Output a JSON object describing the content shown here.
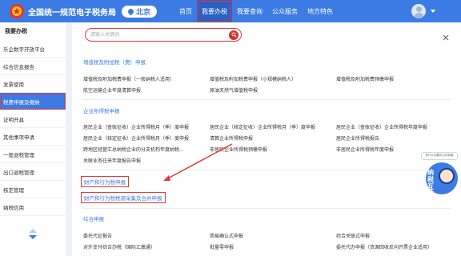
{
  "header": {
    "site_title": "全国统一规范电子税务局",
    "region": "北京",
    "nav": [
      "首页",
      "我要办税",
      "我要查询",
      "公众服务",
      "地方特色"
    ]
  },
  "sidebar": {
    "title": "我要办税",
    "items": [
      "乐企数字开放平台",
      "综合信息报告",
      "发票使用",
      "税费申报及缴纳",
      "证明开具",
      "其他事项申请",
      "一般退税管理",
      "出口退税管理",
      "核定管理",
      "纳税信用"
    ]
  },
  "search": {
    "placeholder": "请输入关键词"
  },
  "sections": {
    "vat": {
      "title": "增值税及附加税（费）申报",
      "rows": [
        [
          "增值税及附加税费申报（一般纳税人适用）",
          "增值税及附加税费申报（小规模纳税人）",
          "增值税及附加税费预缴申报"
        ],
        [
          "航空运输企业年度清算申报",
          "原油天然气增值税申报",
          ""
        ]
      ]
    },
    "cit": {
      "title": "企业所得税申报",
      "rows": [
        [
          "居民企业（查账征收）企业所得税月（季）度申报",
          "居民企业（核定征收）企业所得税月（季）度申报",
          "居民企业（查账征收）企业所得税年度申报"
        ],
        [
          "居民企业（核定征收）企业所得税月（季）度申报",
          "清算企业所得税申报",
          "居民企业所得税报告"
        ],
        [
          "跨地区经营汇总纳税企业的分支机构年度纳税...",
          "非居民企业所得税预缴申报",
          "非居民企业所得税年度申报"
        ],
        [
          "关联业务往来年度报告申报",
          "",
          ""
        ]
      ]
    },
    "property": {
      "label": "财产和行为税申报",
      "merged_label": "财产和行为税税源采集及合并申报"
    },
    "general": {
      "title": "综合申报",
      "rows": [
        [
          "委托代征报告",
          "简易确认式申报",
          "综合关联式申报"
        ],
        [
          "对外支付综合办税（国际汇缴通）",
          "批量零申报",
          "委托代办申报（资源回收反向开票企业适用）"
        ]
      ]
    }
  },
  "assistant": {
    "bubble": "有什么问题可以问我哦",
    "label": "纳税互动"
  },
  "colors": {
    "primary": "#3d7be4",
    "highlight": "#e53935"
  },
  "icons": [
    "emblem-icon",
    "location-pin-icon",
    "avatar-icon",
    "chevron-down-icon",
    "search-icon",
    "close-icon",
    "scroll-up-icon",
    "scroll-down-icon"
  ]
}
